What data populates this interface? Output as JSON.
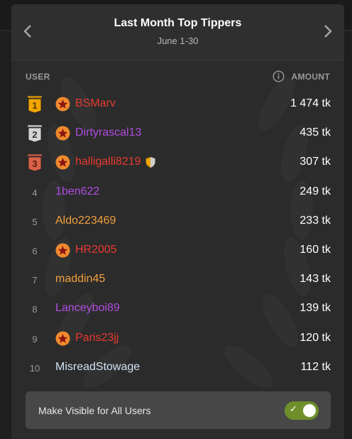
{
  "header": {
    "title": "Last Month Top Tippers",
    "subtitle": "June 1-30"
  },
  "columns": {
    "user": "USER",
    "amount": "AMOUNT"
  },
  "rows": [
    {
      "rank": "1",
      "name": "BSMarv",
      "amount": "1 474 tk",
      "color": "#e83a2f",
      "star": true,
      "medal": "gold"
    },
    {
      "rank": "2",
      "name": "Dirtyrascal13",
      "amount": "435 tk",
      "color": "#b04de0",
      "star": true,
      "medal": "silver"
    },
    {
      "rank": "3",
      "name": "halligalli8219",
      "amount": "307 tk",
      "color": "#e83a2f",
      "star": true,
      "medal": "bronze",
      "shield": true
    },
    {
      "rank": "4",
      "name": "1ben622",
      "amount": "249 tk",
      "color": "#b04de0",
      "star": false
    },
    {
      "rank": "5",
      "name": "Aldo223469",
      "amount": "233 tk",
      "color": "#f0a03c",
      "star": false
    },
    {
      "rank": "6",
      "name": "HR2005",
      "amount": "160 tk",
      "color": "#e83a2f",
      "star": true
    },
    {
      "rank": "7",
      "name": "maddin45",
      "amount": "143 tk",
      "color": "#f0a03c",
      "star": false
    },
    {
      "rank": "8",
      "name": "Lanceyboi89",
      "amount": "139 tk",
      "color": "#b04de0",
      "star": false
    },
    {
      "rank": "9",
      "name": "Paris23jj",
      "amount": "120 tk",
      "color": "#e83a2f",
      "star": true
    },
    {
      "rank": "10",
      "name": "MisreadStowage",
      "amount": "112 tk",
      "color": "#cfe3f5",
      "star": false
    }
  ],
  "toggle": {
    "label": "Make Visible for All Users",
    "on": true
  },
  "colors": {
    "gold": "#f0a500",
    "silver": "#d4d4d4",
    "bronze": "#d9624a",
    "star_badge": "#f08a2e",
    "toggle_on": "#6f8f2c"
  },
  "icons": {
    "prev": "chevron-left-icon",
    "next": "chevron-right-icon",
    "info": "info-icon",
    "star": "star-badge-icon",
    "shield": "shield-icon",
    "check": "checkmark-icon"
  }
}
